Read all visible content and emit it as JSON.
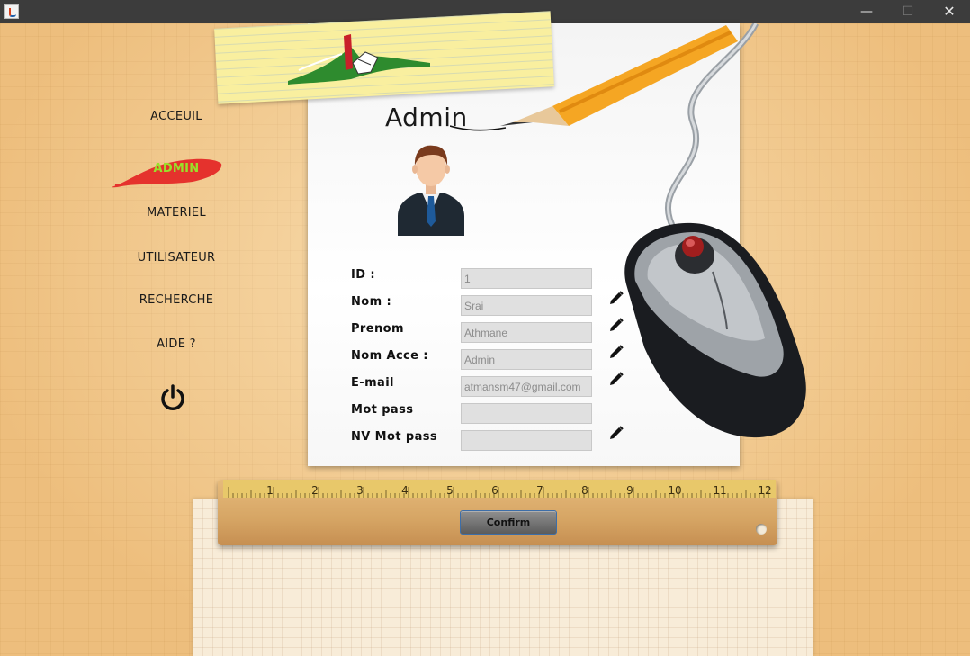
{
  "window": {
    "title": "",
    "icons": {
      "app": "java-icon",
      "minimize": "minimize-icon",
      "maximize": "maximize-icon",
      "close": "close-icon"
    }
  },
  "menu": {
    "items": [
      {
        "label": "ACCEUIL"
      },
      {
        "label": "ADMIN",
        "active": true
      },
      {
        "label": "MATERIEL"
      },
      {
        "label": "UTILISATEUR"
      },
      {
        "label": "RECHERCHE"
      },
      {
        "label": "AIDE ?"
      }
    ],
    "logout_icon": "power-icon",
    "active_color": "#9ae02a",
    "highlight_color": "#e5322d"
  },
  "page": {
    "title": "Admin",
    "avatar_icon": "businessman-avatar-icon",
    "logo_icon": "app-logo-icon"
  },
  "form": {
    "fields": [
      {
        "label": "ID :",
        "value": "1",
        "editable": false
      },
      {
        "label": "Nom :",
        "value": "Srai",
        "editable": true
      },
      {
        "label": "Prenom",
        "value": "Athmane",
        "editable": true
      },
      {
        "label": "Nom Acce :",
        "value": "Admin",
        "editable": true
      },
      {
        "label": "E-mail",
        "value": "atmansm47@gmail.com",
        "editable": true
      },
      {
        "label": "Mot pass",
        "value": "",
        "editable": false
      },
      {
        "label": "NV Mot pass",
        "value": "",
        "editable": true
      }
    ],
    "edit_icon": "pencil-edit-icon",
    "confirm_label": "Confirm"
  },
  "ruler": {
    "numbers": [
      "1",
      "2",
      "3",
      "4",
      "5",
      "6",
      "7",
      "8",
      "9",
      "10",
      "11",
      "12"
    ]
  }
}
